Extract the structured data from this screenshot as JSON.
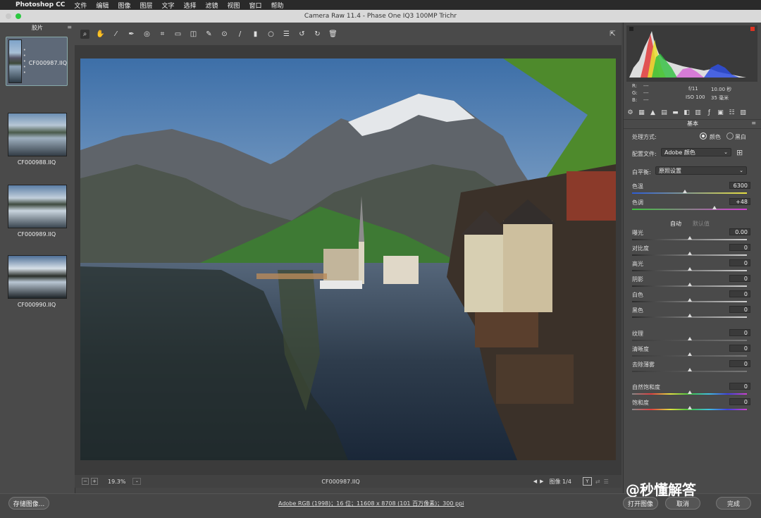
{
  "menubar": {
    "apple": "",
    "app": "Photoshop CC",
    "items": [
      "文件",
      "编辑",
      "图像",
      "图层",
      "文字",
      "选择",
      "滤镜",
      "视图",
      "窗口",
      "帮助"
    ]
  },
  "window_title": "Camera Raw 11.4  -  Phase One IQ3 100MP Trichr",
  "filmstrip": {
    "title": "胶片",
    "items": [
      "CF000987.IIQ",
      "CF000988.IIQ",
      "CF000989.IIQ",
      "CF000990.IIQ"
    ],
    "stars": "• • • • •"
  },
  "status": {
    "zoom": "19.3%",
    "filename": "CF000987.IIQ",
    "image_count": "图像 1/4"
  },
  "bottom": {
    "save_label": "存储图像...",
    "workflow": "Adobe RGB (1998)；16 位；11608 x 8708 (101 百万像素)；300 ppi",
    "open_label": "打开图像",
    "cancel_label": "取消",
    "done_label": "完成",
    "watermark": "@秒懂解答"
  },
  "meta": {
    "r": "R:",
    "g": "G:",
    "b": "B:",
    "dash": "---",
    "aperture": "f/11",
    "shutter": "10.00 秒",
    "iso": "ISO 100",
    "focal": "35 毫米"
  },
  "panel": {
    "section": "基本",
    "treatment_label": "处理方式:",
    "color_label": "颜色",
    "bw_label": "黑白",
    "profile_label": "配置文件:",
    "profile_value": "Adobe 颜色",
    "wb_label": "白平衡:",
    "wb_value": "原照设置",
    "temp_label": "色温",
    "temp_value": "6300",
    "temp_pos": 0.46,
    "tint_label": "色调",
    "tint_value": "+48",
    "tint_pos": 0.72,
    "auto_label": "自动",
    "default_label": "默认值",
    "sliders": [
      {
        "label": "曝光",
        "value": "0.00"
      },
      {
        "label": "对比度",
        "value": "0"
      },
      {
        "label": "高光",
        "value": "0"
      },
      {
        "label": "阴影",
        "value": "0"
      },
      {
        "label": "白色",
        "value": "0"
      },
      {
        "label": "黑色",
        "value": "0"
      },
      {
        "label": "纹理",
        "value": "0"
      },
      {
        "label": "清晰度",
        "value": "0"
      },
      {
        "label": "去除薄雾",
        "value": "0"
      },
      {
        "label": "自然饱和度",
        "value": "0"
      },
      {
        "label": "饱和度",
        "value": "0"
      }
    ]
  }
}
